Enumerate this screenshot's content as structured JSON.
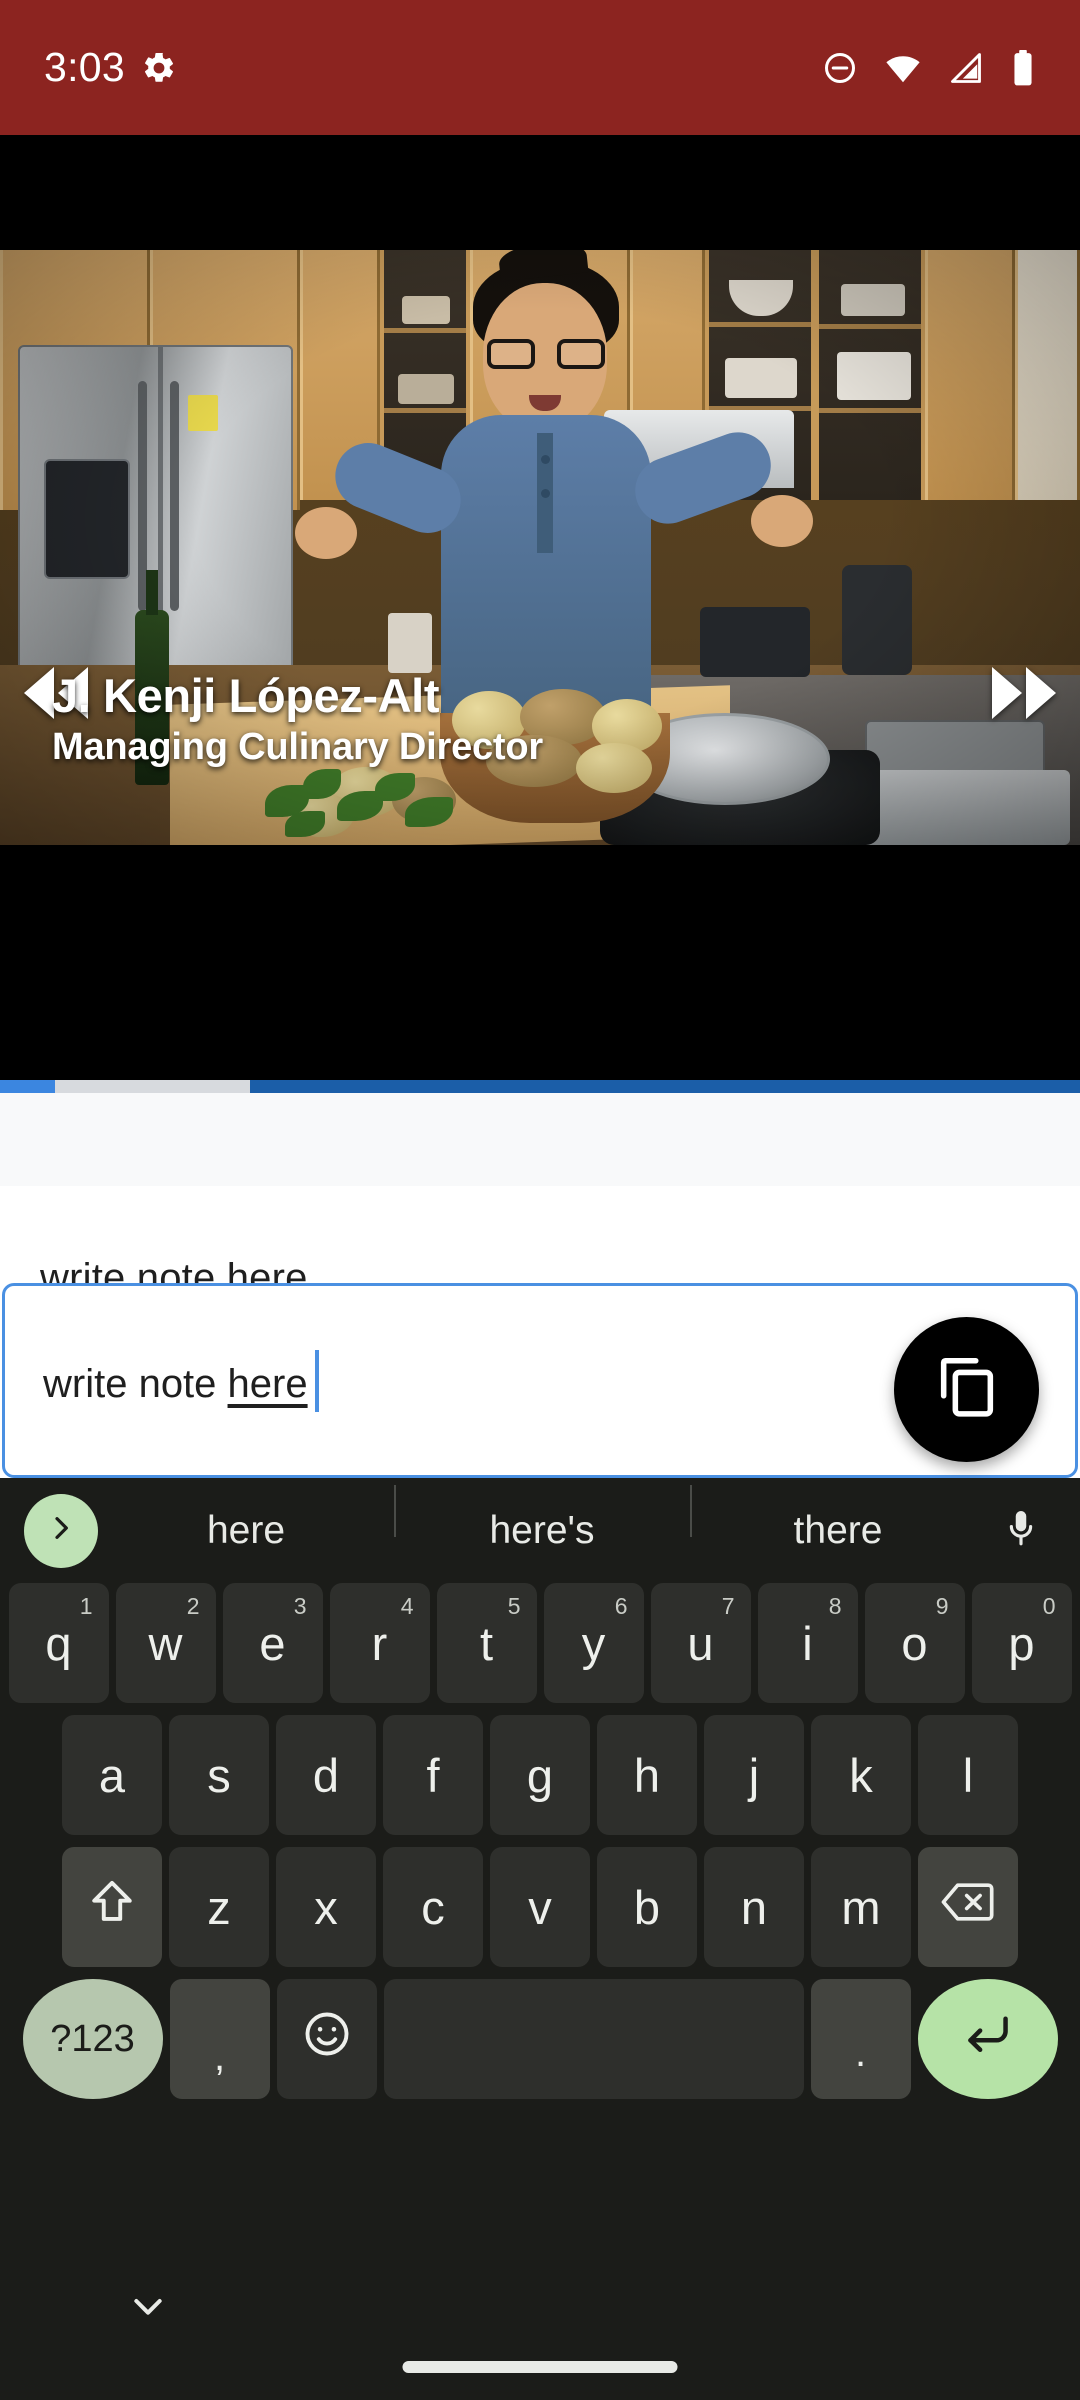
{
  "status_bar": {
    "clock": "3:03",
    "background_color": "#8c2420",
    "icons": [
      "gear-icon",
      "do-not-disturb-icon",
      "wifi-icon",
      "cellular-signal-icon",
      "battery-icon"
    ]
  },
  "video": {
    "caption_name": "J. Kenji López-Alt",
    "caption_role": "Managing Culinary Director",
    "rewind_label": "rewind",
    "forward_label": "fast forward",
    "progress": {
      "played_percent": 5,
      "buffered_percent": 23,
      "played_color": "#3b86e0",
      "buffered_color": "#d7dade",
      "track_color": "#1b5ea8"
    }
  },
  "note": {
    "label": "write note here",
    "input_text": "write note here",
    "input_text_plain": "write note ",
    "input_text_composing": "here",
    "placeholder": "write note here",
    "accent_color": "#4a90e2",
    "fab_icon": "copy-icon"
  },
  "keyboard": {
    "suggestions": [
      "here",
      "here's",
      "there"
    ],
    "expand_icon": "chevron-right-icon",
    "mic_icon": "microphone-icon",
    "row1": [
      {
        "key": "q",
        "num": "1"
      },
      {
        "key": "w",
        "num": "2"
      },
      {
        "key": "e",
        "num": "3"
      },
      {
        "key": "r",
        "num": "4"
      },
      {
        "key": "t",
        "num": "5"
      },
      {
        "key": "y",
        "num": "6"
      },
      {
        "key": "u",
        "num": "7"
      },
      {
        "key": "i",
        "num": "8"
      },
      {
        "key": "o",
        "num": "9"
      },
      {
        "key": "p",
        "num": "0"
      }
    ],
    "row2": [
      "a",
      "s",
      "d",
      "f",
      "g",
      "h",
      "j",
      "k",
      "l"
    ],
    "row3": [
      "z",
      "x",
      "c",
      "v",
      "b",
      "n",
      "m"
    ],
    "shift_label": "shift",
    "backspace_label": "backspace",
    "symbols_label": "?123",
    "comma_label": ",",
    "emoji_label": "emoji",
    "space_label": "space",
    "period_label": ".",
    "enter_label": "enter",
    "accent_key_color": "#b6e3a7",
    "background_color": "#1b1c19"
  },
  "nav_bar": {
    "hide_keyboard_icon": "chevron-down-icon",
    "home_indicator": "gesture-home-bar"
  }
}
